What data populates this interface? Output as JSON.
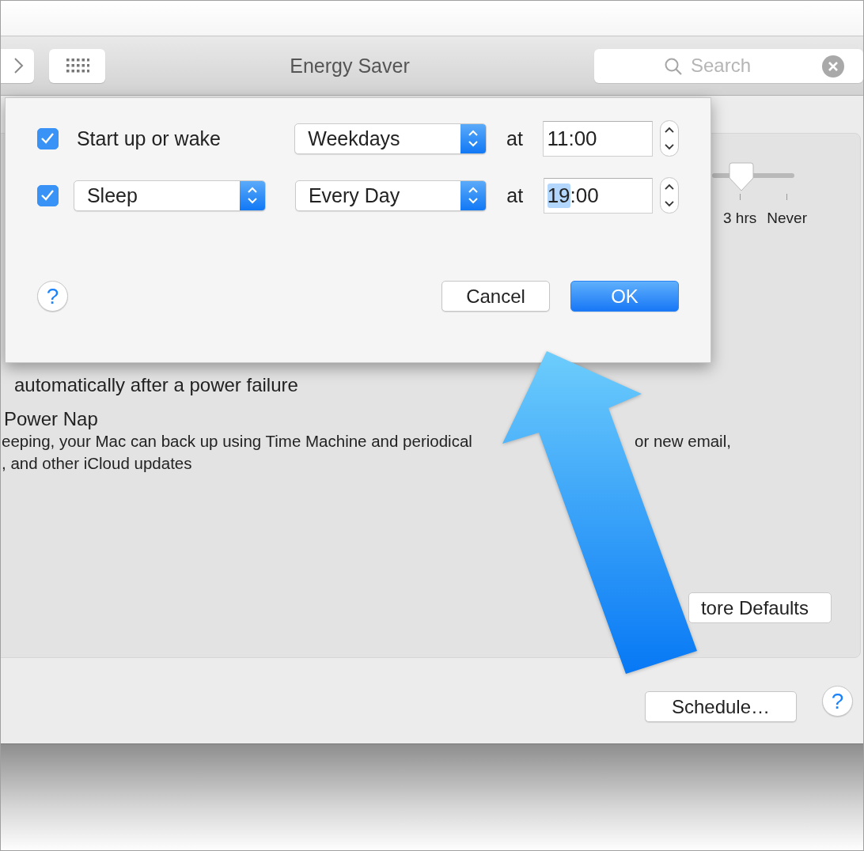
{
  "window": {
    "title": "Energy Saver",
    "search": {
      "placeholder": "Search"
    }
  },
  "panel": {
    "slider": {
      "level": 0.36,
      "labels": [
        "3 hrs",
        "Never"
      ]
    },
    "power_failure_label": "automatically after a power failure",
    "power_nap_label": "Power Nap",
    "power_nap_description": [
      [
        "eeping, your Mac can back up using Time Machine and periodical",
        "or new email,"
      ],
      [
        ", and other iCloud updates"
      ]
    ],
    "restore_button": "tore Defaults"
  },
  "schedule_button": "Schedule…",
  "help_button": "?",
  "dialog": {
    "rows": [
      {
        "checked": true,
        "kind": "label",
        "event": "Start up or wake",
        "day": "Weekdays",
        "at": "at",
        "time": [
          {
            "text": "11:00",
            "selected": false
          }
        ]
      },
      {
        "checked": true,
        "kind": "popup",
        "event": "Sleep",
        "day": "Every Day",
        "at": "at",
        "time": [
          {
            "text": "19",
            "selected": true
          },
          {
            "text": ":00",
            "selected": false
          }
        ]
      }
    ],
    "help_button": "?",
    "buttons": [
      {
        "label": "Cancel",
        "kind": "default"
      },
      {
        "label": "OK",
        "kind": "primary"
      }
    ]
  }
}
